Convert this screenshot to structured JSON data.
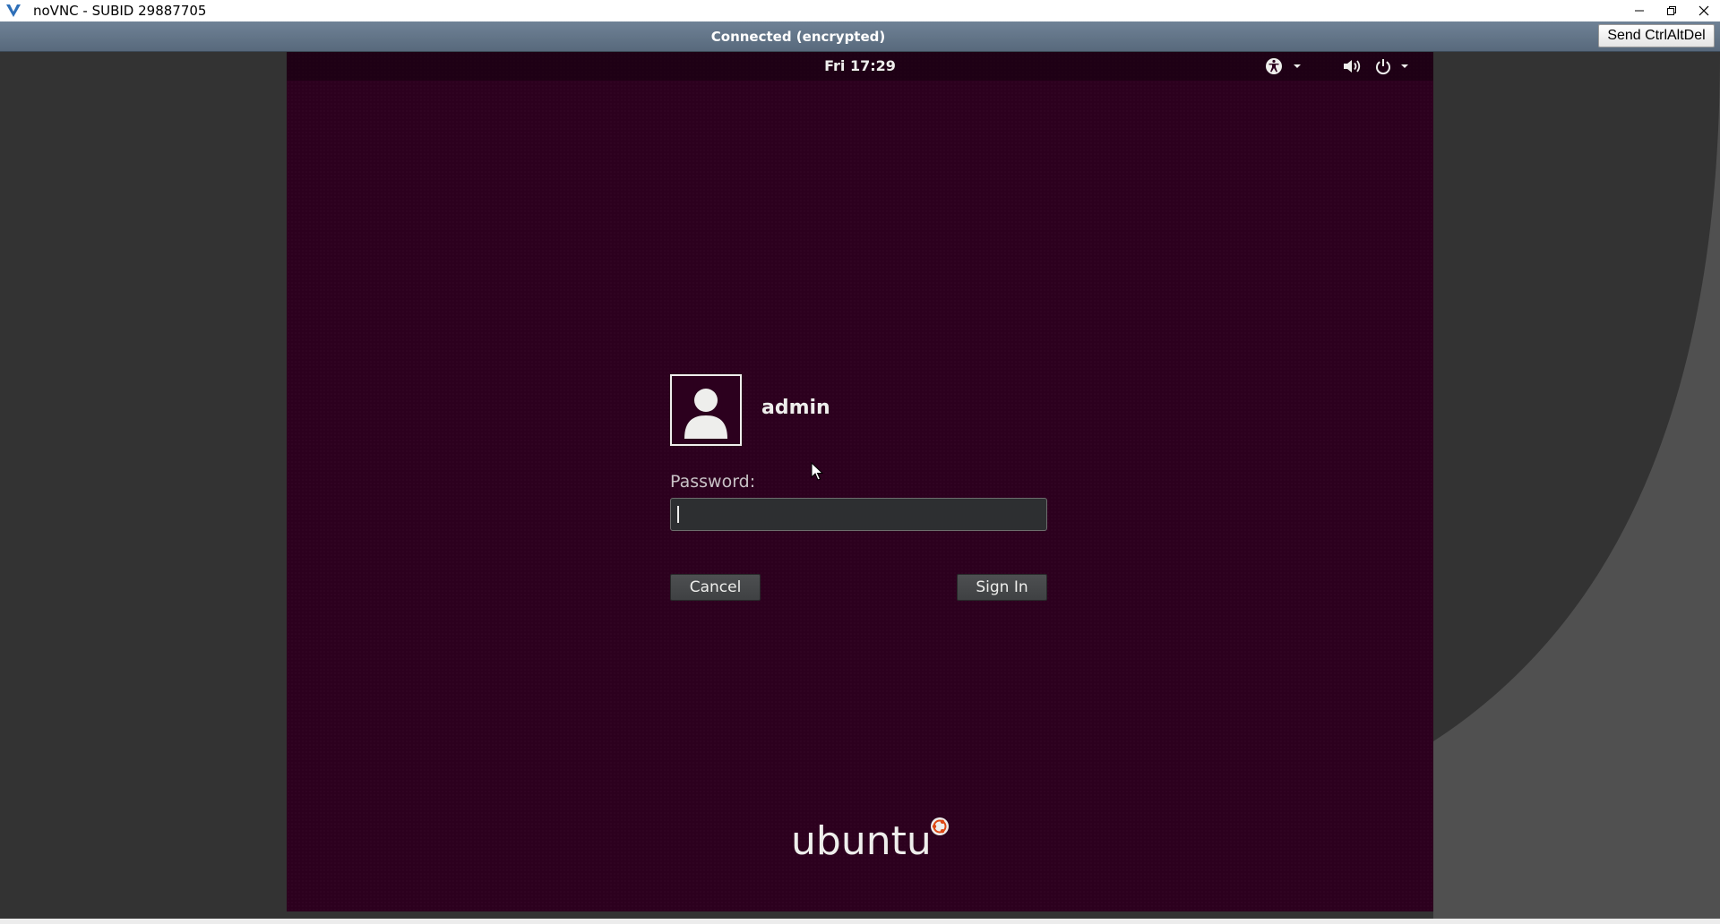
{
  "window": {
    "title": "noVNC - SUBID 29887705",
    "icon": "novnc-logo-icon",
    "controls": [
      "minimize-icon",
      "restore-icon",
      "close-icon"
    ]
  },
  "novnc": {
    "status": "Connected (encrypted)",
    "send_cad_label": "Send CtrlAltDel"
  },
  "gnome": {
    "clock": "Fri 17:29",
    "tray": [
      "accessibility-icon",
      "volume-icon",
      "power-icon"
    ]
  },
  "login": {
    "username": "admin",
    "password_label": "Password:",
    "password_value": "",
    "cancel_label": "Cancel",
    "signin_label": "Sign In",
    "avatar": "user-avatar-icon"
  },
  "branding": {
    "logo_text": "ubuntu"
  },
  "colors": {
    "vm_background": "#2c001e",
    "novnc_status_bar": "#6f8296",
    "novnc_background": "#333333"
  }
}
